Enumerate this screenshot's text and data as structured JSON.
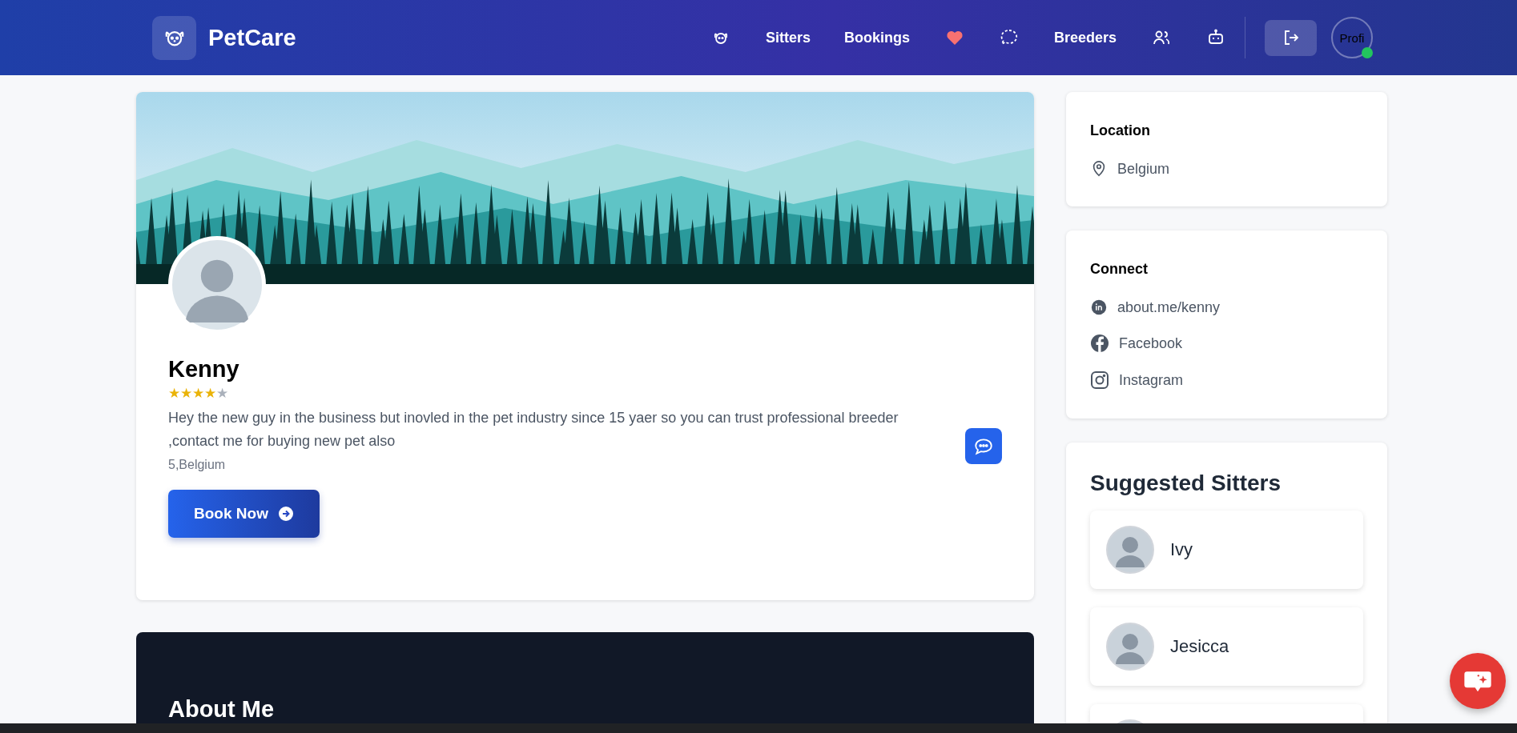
{
  "header": {
    "brand": "PetCare",
    "nav_links": [
      "Sitters",
      "Bookings",
      "Breeders"
    ],
    "avatar_alt": "Profi",
    "online": true
  },
  "profile": {
    "name": "Kenny",
    "stars": 4,
    "bio": "Hey the new guy in the business but inovled in the pet industry since 15 yaer so you can trust professional breeder ,contact me for buying new pet also",
    "address": "5,Belgium",
    "book_button": "Book Now"
  },
  "about": {
    "title": "About Me"
  },
  "location": {
    "title": "Location",
    "place": "Belgium"
  },
  "connect": {
    "title": "Connect",
    "links": [
      {
        "kind": "website",
        "label": "about.me/kenny"
      },
      {
        "kind": "facebook",
        "label": "Facebook"
      },
      {
        "kind": "instagram",
        "label": "Instagram"
      }
    ]
  },
  "suggested": {
    "title": "Suggested Sitters",
    "sitters": [
      {
        "kind": "full",
        "name": "Ivy"
      },
      {
        "kind": "full",
        "name": "Jesicca"
      },
      {
        "kind": "cut_off"
      }
    ]
  }
}
